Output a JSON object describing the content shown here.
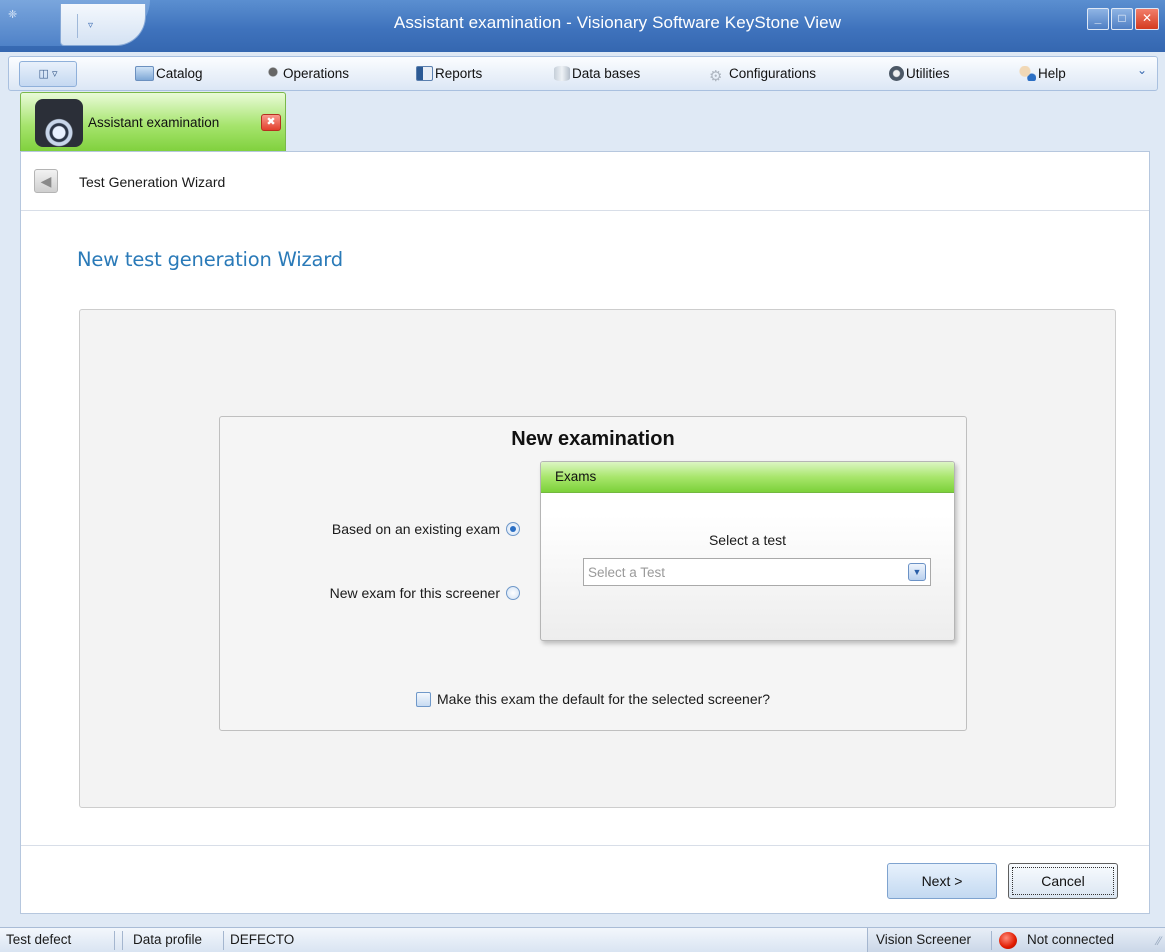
{
  "window": {
    "title": "Assistant examination - Visionary Software KeyStone View",
    "minimize": "_",
    "maximize": "□",
    "close": "✕"
  },
  "menu": {
    "items": [
      {
        "label": "Catalog",
        "icon": "catalog-icon"
      },
      {
        "label": "Operations",
        "icon": "operations-icon"
      },
      {
        "label": "Reports",
        "icon": "reports-icon"
      },
      {
        "label": "Data bases",
        "icon": "database-icon"
      },
      {
        "label": "Configurations",
        "icon": "gear-icon"
      },
      {
        "label": "Utilities",
        "icon": "utilities-icon"
      },
      {
        "label": "Help",
        "icon": "help-icon"
      }
    ]
  },
  "doc_tab": {
    "label": "Assistant examination",
    "active_color": "#8fd84e"
  },
  "nav": {
    "breadcrumb": "Test Generation Wizard"
  },
  "wizard": {
    "heading": "New test generation Wizard",
    "title": "New examination",
    "option_existing": "Based on an existing exam",
    "option_new": "New exam for this screener",
    "selected_option": "existing",
    "exams_panel": {
      "header": "Exams",
      "select_label": "Select a test",
      "select_placeholder": "Select a Test"
    },
    "default_checkbox_label": "Make this exam the default for the selected screener?",
    "default_checked": false,
    "next_label": "Next >",
    "cancel_label": "Cancel"
  },
  "status": {
    "left_label": "Test defect",
    "profile_label": "Data profile",
    "profile_value": "DEFECTO",
    "device": "Vision Screener",
    "connection": "Not connected",
    "connection_color": "#e11b00"
  },
  "colors": {
    "title_bar": "#3f73bd",
    "accent_green": "#8fd84e",
    "heading_blue": "#2a7ab8"
  }
}
